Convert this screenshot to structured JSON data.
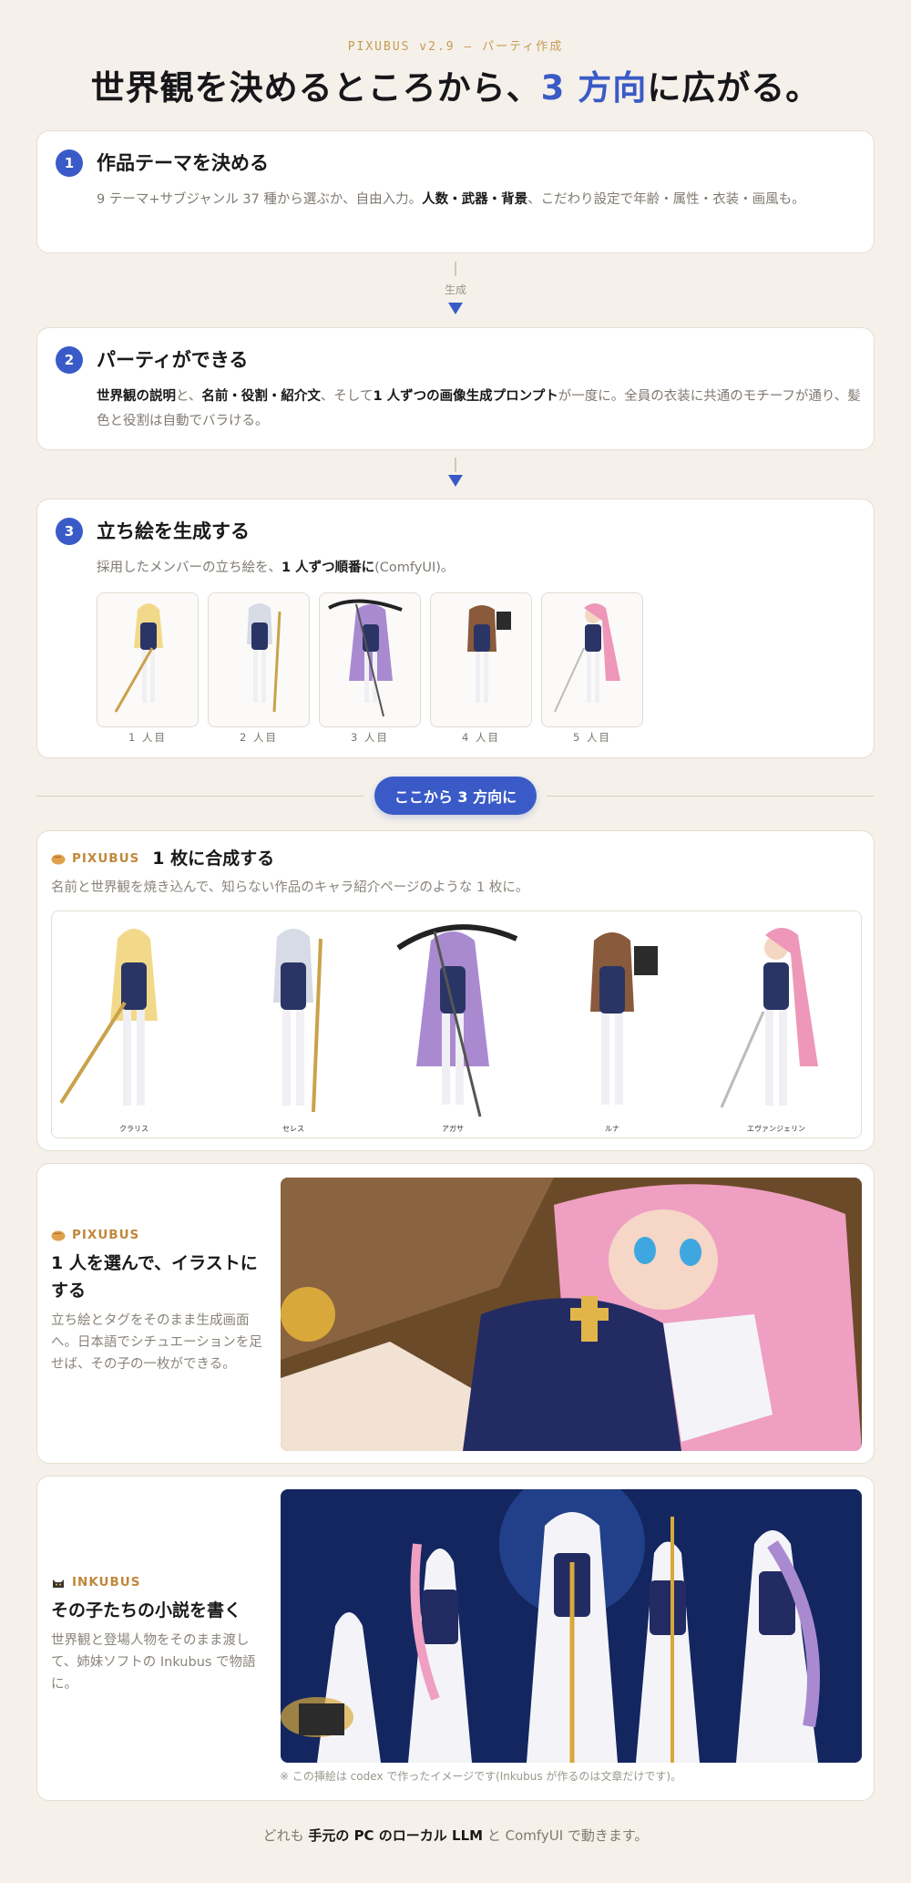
{
  "header": {
    "kicker": "PIXUBUS v2.9 — パーティ作成",
    "title_prefix": "世界観を決めるところから、",
    "title_accent": "3 方向",
    "title_suffix": "に広がる。"
  },
  "steps": [
    {
      "num": "1",
      "title": "作品テーマを決める",
      "desc_a": "9 テーマ+サブジャンル 37 種から選ぶか、自由入力。",
      "desc_b": "人数・武器・背景",
      "desc_c": "、こだわり設定で年齢・属性・衣装・画風も。"
    },
    {
      "num": "2",
      "title": "パーティができる",
      "desc_a": "世界観の説明",
      "desc_b": "と、",
      "desc_c": "名前・役割・紹介文",
      "desc_d": "、そして",
      "desc_e": "1 人ずつの画像生成プロンプト",
      "desc_f": "が一度に。全員の衣装に共通のモチーフが通り、髪色と役割は自動でバラける。"
    },
    {
      "num": "3",
      "title": "立ち絵を生成する",
      "desc_a": "採用したメンバーの立ち絵を、",
      "desc_b": "1 人ずつ順番に",
      "desc_c": "(ComfyUI)。"
    }
  ],
  "connector_label": "生成",
  "thumbs": [
    "1 人目",
    "2 人目",
    "3 人目",
    "4 人目",
    "5 人目"
  ],
  "branch_pill": "ここから 3 方向に",
  "option1": {
    "brand": "PIXUBUS",
    "title": "1 枚に合成する",
    "desc": "名前と世界観を焼き込んで、知らない作品のキャラ紹介ページのような 1 枚に。",
    "names": [
      "クラリス",
      "セレス",
      "アガサ",
      "ルナ",
      "エヴァンジェリン"
    ]
  },
  "option2": {
    "brand": "PIXUBUS",
    "title": "1 人を選んで、イラストにする",
    "desc": "立ち絵とタグをそのまま生成画面へ。日本語でシチュエーションを足せば、その子の一枚ができる。"
  },
  "option3": {
    "brand": "INKUBUS",
    "title": "その子たちの小説を書く",
    "desc": "世界観と登場人物をそのまま渡して、姉妹ソフトの Inkubus で物語に。",
    "note": "※ この挿絵は codex で作ったイメージです(Inkubus が作るのは文章だけです)。"
  },
  "footer": {
    "a": "どれも ",
    "b": "手元の PC のローカル LLM",
    "c": " と ComfyUI で動きます。"
  },
  "colors": {
    "accent": "#3a5bc7",
    "brand_gold": "#c0883b",
    "background": "#f5f1ea"
  },
  "icons": [
    "bread-icon",
    "cat-icon"
  ]
}
